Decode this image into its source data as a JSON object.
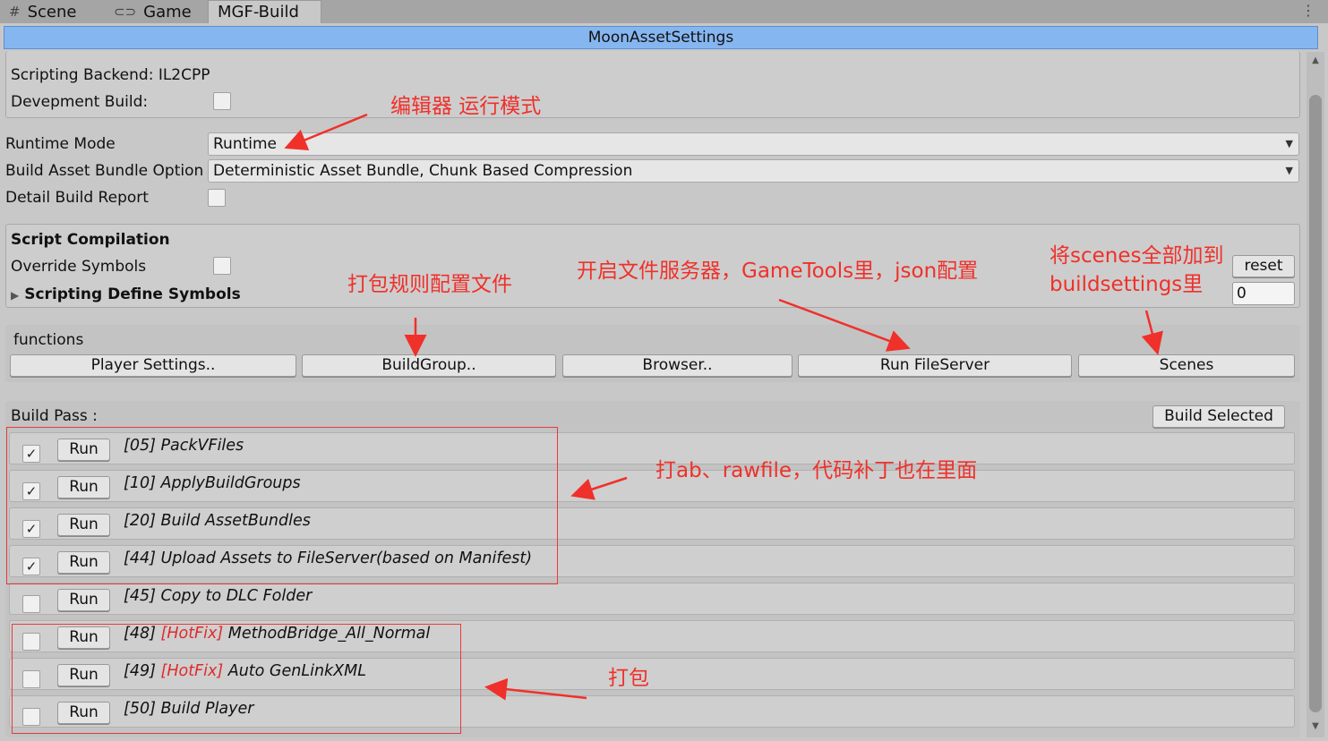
{
  "tabs": [
    {
      "icon": "grid-icon",
      "label": "Scene"
    },
    {
      "icon": "gamepad-icon",
      "label": "Game"
    },
    {
      "label": "MGF-Build"
    }
  ],
  "header": {
    "title": "MoonAssetSettings"
  },
  "top_section": {
    "scripting_backend": "Scripting Backend: IL2CPP",
    "devepment_build_label": "Devepment Build:",
    "devepment_build_checked": false
  },
  "settings": {
    "runtime_mode_label": "Runtime Mode",
    "runtime_mode_value": "Runtime",
    "build_option_label": "Build Asset Bundle Option",
    "build_option_value": "Deterministic Asset Bundle, Chunk Based Compression",
    "detail_report_label": "Detail Build Report",
    "detail_report_checked": false
  },
  "script_compilation": {
    "title": "Script Compilation",
    "override_label": "Override Symbols",
    "override_checked": false,
    "define_symbols_label": "Scripting Define Symbols",
    "reset_label": "reset",
    "count_value": "0"
  },
  "functions": {
    "title": "functions",
    "buttons": [
      "Player Settings..",
      "BuildGroup..",
      "Browser..",
      "Run FileServer",
      "Scenes"
    ]
  },
  "build_pass": {
    "title": "Build Pass :",
    "build_selected_label": "Build Selected",
    "run_label": "Run",
    "items": [
      {
        "prefix": "[05] ",
        "tag": "",
        "name": "PackVFiles",
        "checked": true
      },
      {
        "prefix": "[10] ",
        "tag": "",
        "name": "ApplyBuildGroups",
        "checked": true
      },
      {
        "prefix": "[20] ",
        "tag": "",
        "name": "Build AssetBundles",
        "checked": true
      },
      {
        "prefix": "[44] ",
        "tag": "",
        "name": "Upload Assets to FileServer(based on Manifest)",
        "checked": true
      },
      {
        "prefix": "[45] ",
        "tag": "",
        "name": "Copy to DLC Folder",
        "checked": false
      },
      {
        "prefix": "[48] ",
        "tag": "[HotFix]",
        "name": " MethodBridge_All_Normal",
        "checked": false
      },
      {
        "prefix": "[49] ",
        "tag": "[HotFix]",
        "name": " Auto GenLinkXML",
        "checked": false
      },
      {
        "prefix": "[50] ",
        "tag": "",
        "name": "Build Player",
        "checked": false
      }
    ]
  },
  "annotations": {
    "editor_mode": "编辑器 运行模式",
    "build_rules": "打包规则配置文件",
    "file_server": "开启文件服务器，GameTools里，json配置",
    "scenes_line1": "将scenes全部加到",
    "scenes_line2": "buildsettings里",
    "ab_rawfile": "打ab、rawfile，代码补丁也在里面",
    "pack": "打包"
  },
  "colors": {
    "header_bg": "#86b6f0",
    "annotation_red": "#f0302a",
    "hotfix_red": "#e02a2a"
  }
}
